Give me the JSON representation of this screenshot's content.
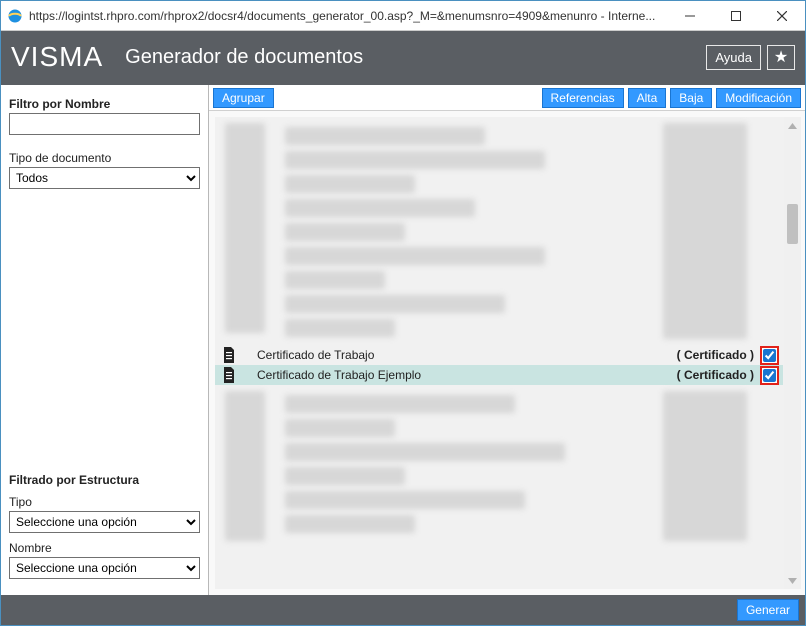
{
  "window": {
    "url_display": "https://logintst.rhpro.com/rhprox2/docsr4/documents_generator_00.asp?_M=&menumsnro=4909&menunro - Interne..."
  },
  "header": {
    "logo_text": "VISMA",
    "page_title": "Generador de documentos",
    "help_label": "Ayuda"
  },
  "sidebar": {
    "filter_name_label": "Filtro por Nombre",
    "filter_name_value": "",
    "doc_type_label": "Tipo de documento",
    "doc_type_value": "Todos",
    "structure_filter_label": "Filtrado por Estructura",
    "type_label": "Tipo",
    "type_value": "Seleccione una opción",
    "name_label": "Nombre",
    "name_value": "Seleccione una opción"
  },
  "toolbar": {
    "group_label": "Agrupar",
    "references_label": "Referencias",
    "alta_label": "Alta",
    "baja_label": "Baja",
    "modify_label": "Modificación"
  },
  "rows": [
    {
      "name": "Certificado de Trabajo",
      "type": "( Certificado )",
      "checked": true
    },
    {
      "name": "Certificado de Trabajo Ejemplo",
      "type": "( Certificado )",
      "checked": true
    }
  ],
  "footer": {
    "generate_label": "Generar"
  }
}
